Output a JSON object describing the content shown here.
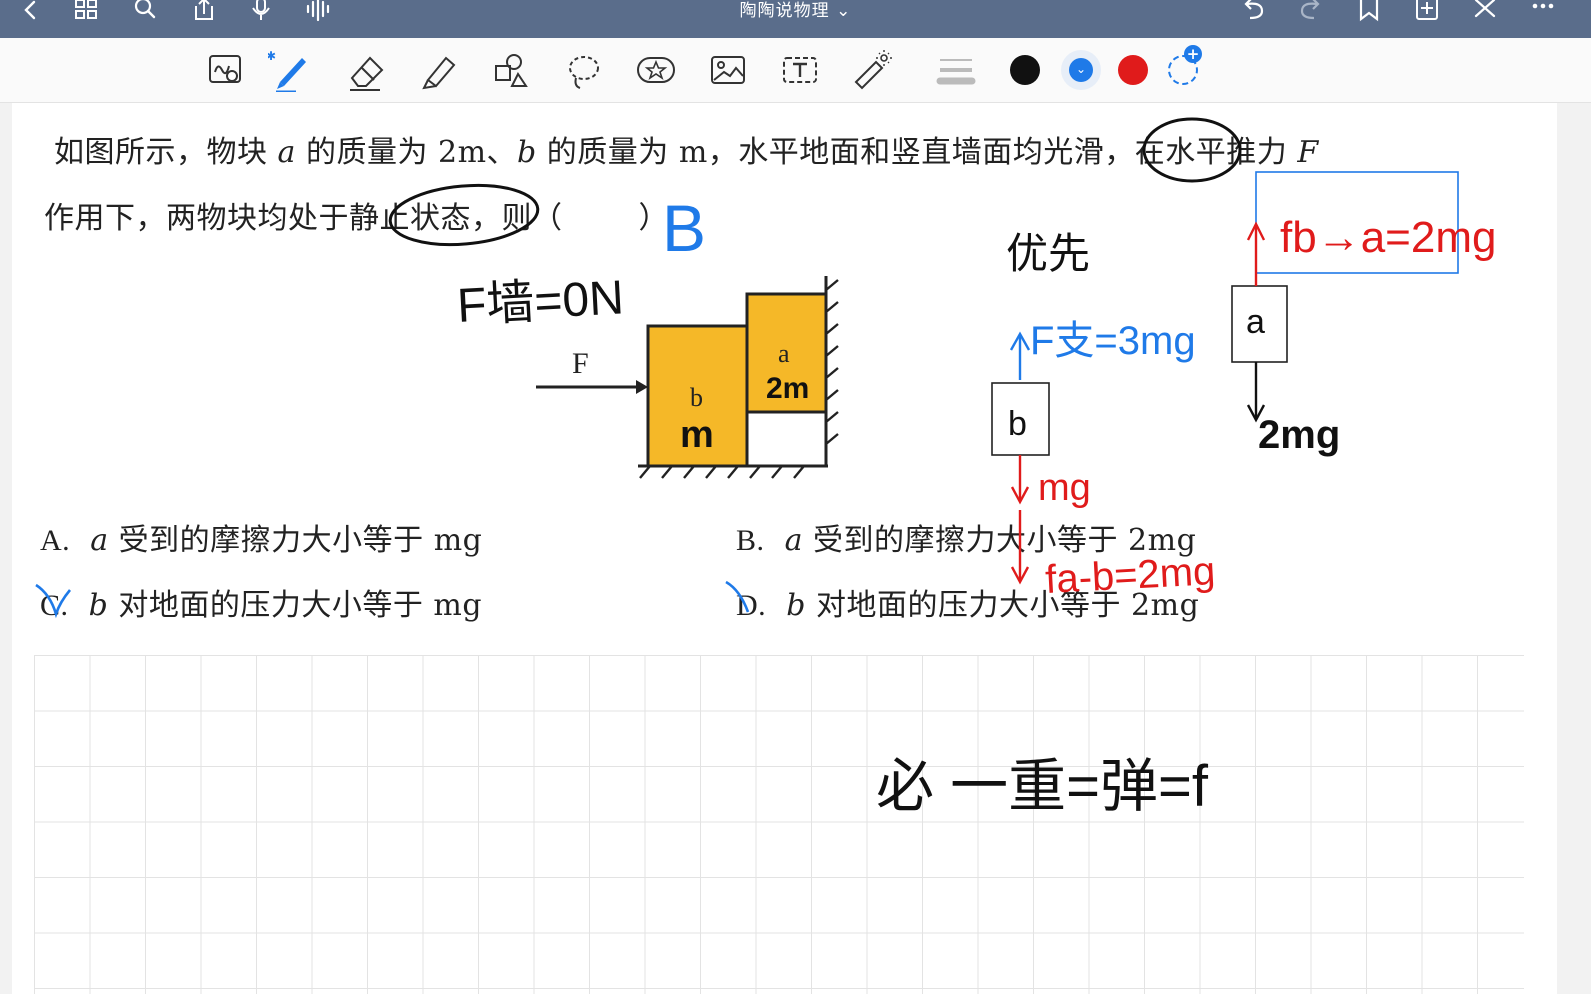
{
  "app": {
    "title": "陶陶说物理",
    "title_chevron": "⌄"
  },
  "nav_icons": [
    "back-icon",
    "grid-icon",
    "search-icon",
    "share-icon",
    "mic-icon",
    "audio-wave-icon",
    "undo-icon",
    "redo-icon",
    "bookmark-icon",
    "add-page-icon",
    "close-icon",
    "more-icon"
  ],
  "toolbar": {
    "tools": [
      "lasso-zoom-icon",
      "pen-icon",
      "eraser-icon",
      "highlighter-icon",
      "shapes-icon",
      "lasso-icon",
      "sticker-icon",
      "image-icon",
      "text-icon",
      "laser-pointer-icon",
      "stroke-width-icon"
    ],
    "colors": [
      "#111111",
      "#1f7ae8",
      "#e01b1b"
    ],
    "selected_color": "#1f7ae8",
    "add_color_label": "+"
  },
  "question": {
    "line1_a": "如图所示，物块 ",
    "var_a": "a",
    "line1_b": " 的质量为 2m、",
    "var_b": "b",
    "line1_c": " 的质量为 m，水平地面和竖直墙面均光滑，在水平推力 ",
    "var_F": "F",
    "line2": "作用下，两物块均处于静止状态，则（",
    "line2_end": "）"
  },
  "figure": {
    "force_label": "F",
    "block_a_label": "a",
    "block_b_label": "b"
  },
  "options": [
    {
      "letter": "A.",
      "var": "a",
      "text": " 受到的摩擦力大小等于 mg"
    },
    {
      "letter": "B.",
      "var": "a",
      "text": " 受到的摩擦力大小等于 2mg"
    },
    {
      "letter": "C.",
      "var": "b",
      "text": " 对地面的压力大小等于 mg"
    },
    {
      "letter": "D.",
      "var": "b",
      "text": " 对地面的压力大小等于 2mg"
    }
  ],
  "handwriting": {
    "answer": "B",
    "f_wall": "F墙=0N",
    "mass_a": "2m",
    "mass_b": "m",
    "priority": "优先",
    "f_ground": "F支=3mg",
    "box_b": "b",
    "mg_b": "mg",
    "f_a_b": "fa-b=2mg",
    "f_b_a": "fb→a=2mg",
    "box_a": "a",
    "mg_a": "2mg",
    "formula": "必 一重=弹=f"
  }
}
